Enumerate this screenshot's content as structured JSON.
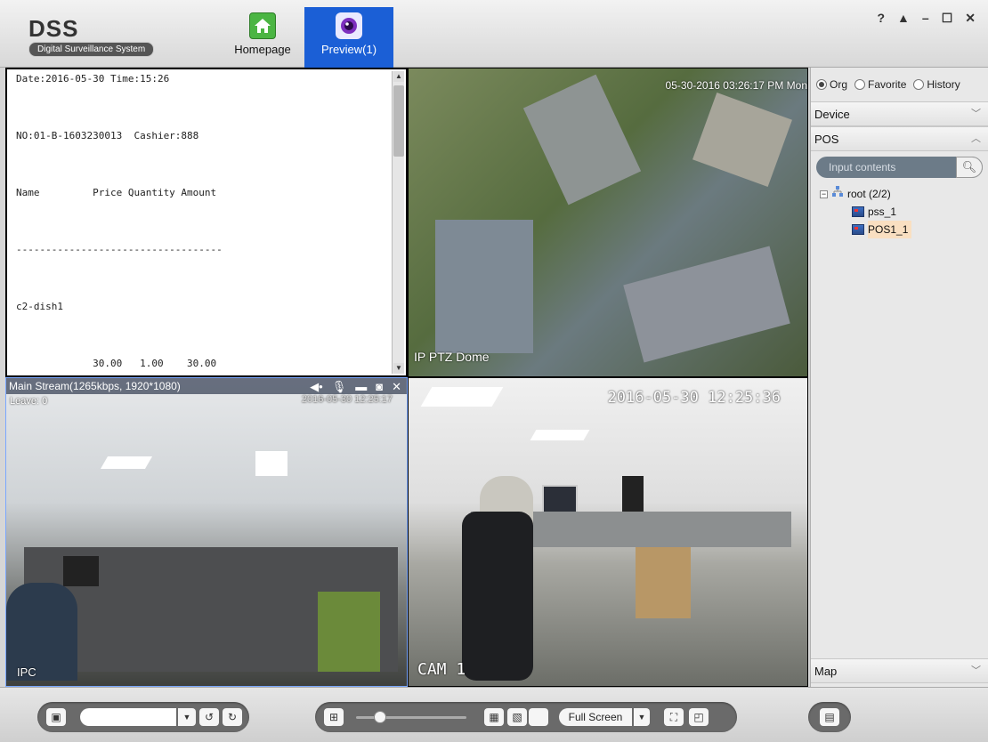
{
  "app": {
    "logo": "DSS",
    "logo_subtitle": "Digital Surveillance System",
    "tabs": [
      {
        "label": "Homepage"
      },
      {
        "label": "Preview(1)"
      }
    ],
    "window_controls": [
      "?",
      "▲",
      "–",
      "☐",
      "✕"
    ]
  },
  "panes": {
    "pos": {
      "lines": [
        "Date:2016-05-30 Time:15:26",
        "NO:01-B-1603230013  Cashier:888",
        "Name         Price Quantity Amount",
        "-----------------------------------",
        "c2-dish1",
        "             30.00   1.00    30.00"
      ]
    },
    "ptz": {
      "timestamp": "05-30-2016 03:26:17 PM Mon",
      "label": "IP PTZ Dome"
    },
    "ipc": {
      "stream_info": "Main Stream(1265kbps, 1920*1080)",
      "osd_top": "Leave: 0",
      "timestamp": "2016-05-30 12:25:17",
      "label": "IPC"
    },
    "cam1": {
      "timestamp": "2016-05-30 12:25:36",
      "label": "CAM 1"
    }
  },
  "panel": {
    "radios": [
      {
        "label": "Org",
        "checked": true
      },
      {
        "label": "Favorite",
        "checked": false
      },
      {
        "label": "History",
        "checked": false
      }
    ],
    "sections": {
      "device": "Device",
      "pos": "POS",
      "map": "Map"
    },
    "search_placeholder": "Input contents",
    "tree": {
      "root": "root (2/2)",
      "children": [
        "pss_1",
        "POS1_1"
      ],
      "selected": "POS1_1"
    }
  },
  "toolbar": {
    "fullscreen_label": "Full Screen"
  }
}
